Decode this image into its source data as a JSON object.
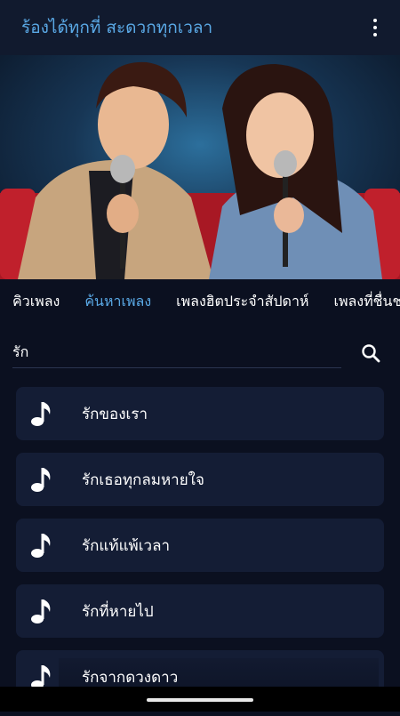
{
  "appbar": {
    "title": "ร้องได้ทุกที่ สะดวกทุกเวลา"
  },
  "tabs": [
    {
      "label": "คิวเพลง"
    },
    {
      "label": "ค้นหาเพลง",
      "active": true
    },
    {
      "label": "เพลงฮิตประจำสัปดาห์"
    },
    {
      "label": "เพลงที่ชื่นชอบ"
    }
  ],
  "search": {
    "value": "รัก"
  },
  "songs": [
    {
      "title": "รักของเรา"
    },
    {
      "title": "รักเธอทุกลมหายใจ"
    },
    {
      "title": "รักแท้แพ้เวลา"
    },
    {
      "title": "รักที่หายไป"
    },
    {
      "title": "รักจากดวงดาว"
    }
  ],
  "colors": {
    "accent": "#5aa9e6",
    "background": "#0b1020",
    "card": "#141d35",
    "appbar": "#111a2e"
  },
  "icons": {
    "menu": "more-vertical-icon",
    "search": "search-icon",
    "song": "music-note-icon"
  }
}
